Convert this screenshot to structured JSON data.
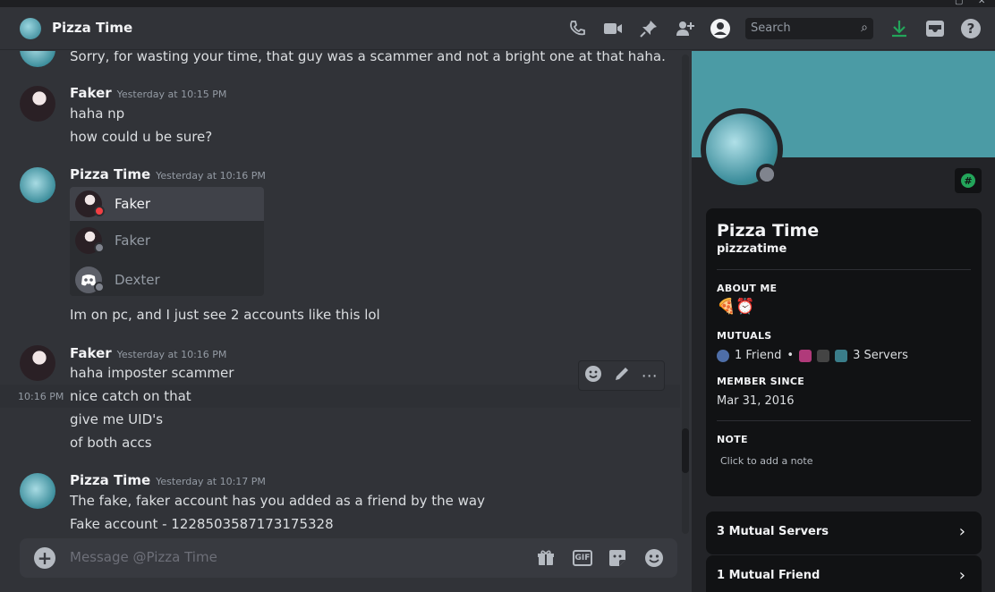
{
  "header": {
    "title": "Pizza Time",
    "search_placeholder": "Search"
  },
  "messages": {
    "top_line": "Sorry, for wasting your time, that guy was a scammer and not a bright one at that haha.",
    "g1": {
      "name": "Faker",
      "time": "Yesterday at 10:15 PM",
      "lines": [
        "haha np",
        "how could u be sure?"
      ]
    },
    "g2": {
      "name": "Pizza Time",
      "time": "Yesterday at 10:16 PM",
      "after_popup": "Im on pc, and I just see 2 accounts like this lol"
    },
    "popup": [
      "Faker",
      "Faker",
      "Dexter"
    ],
    "g3": {
      "name": "Faker",
      "time": "Yesterday at 10:16 PM",
      "hover_time": "10:16 PM",
      "lines": [
        "haha imposter scammer",
        "nice catch on that",
        "give me UID's",
        "of both accs"
      ]
    },
    "g4": {
      "name": "Pizza Time",
      "time": "Yesterday at 10:17 PM",
      "lines": [
        "The fake, faker account has you added as a friend by the way",
        "Fake account - 1228503587173175328"
      ]
    }
  },
  "composer": {
    "placeholder": "Message @Pizza Time",
    "gif_label": "GIF"
  },
  "profile": {
    "display_name": "Pizza Time",
    "username": "pizzzatime",
    "about_label": "ABOUT ME",
    "about_value": "🍕⏰",
    "mutuals_label": "MUTUALS",
    "mutual_friends": "1 Friend",
    "mutual_servers": "3 Servers",
    "member_label": "MEMBER SINCE",
    "member_value": "Mar 31, 2016",
    "note_label": "NOTE",
    "note_placeholder": "Click to add a note",
    "mutual_servers_row": "3 Mutual Servers",
    "mutual_friend_row": "1 Mutual Friend"
  },
  "colors": {
    "accent_green": "#23a55a",
    "banner": "#4b9ba5",
    "dnd_red": "#f23f43"
  }
}
